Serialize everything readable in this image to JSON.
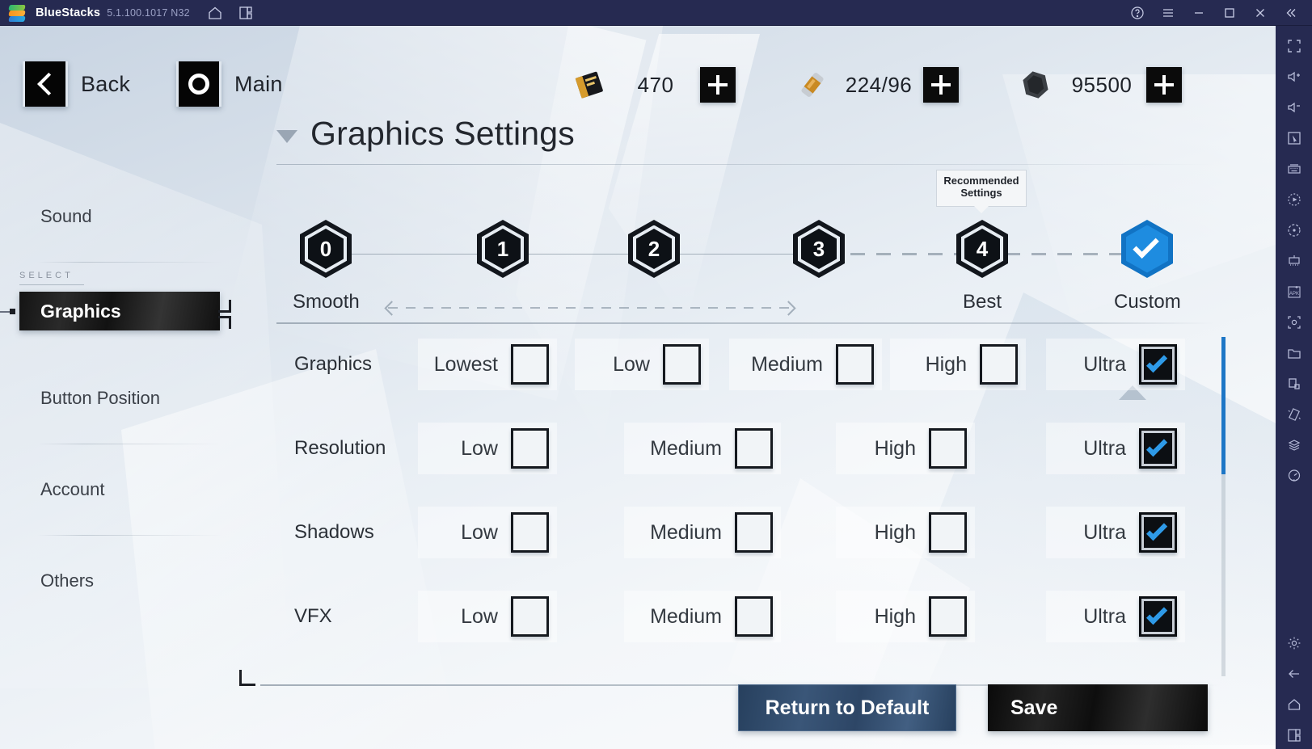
{
  "titlebar": {
    "app_name": "BlueStacks",
    "version": "5.1.100.1017 N32",
    "icons": [
      "home-icon",
      "multi-instance-icon"
    ],
    "window_icons": [
      "help-icon",
      "menu-icon",
      "minimize-icon",
      "maximize-icon",
      "close-icon",
      "collapse-icon"
    ]
  },
  "game": {
    "nav": {
      "back_label": "Back",
      "main_label": "Main"
    },
    "currencies": [
      {
        "icon": "uc-card-icon",
        "value": "470",
        "add_label": "+"
      },
      {
        "icon": "silver-fragment-icon",
        "value": "224/96",
        "add_label": "+"
      },
      {
        "icon": "nut-icon",
        "value": "95500",
        "add_label": "+"
      }
    ],
    "left_menu": {
      "select_hint": "SELECT",
      "items": [
        {
          "label": "Sound",
          "selected": false
        },
        {
          "label": "Graphics",
          "selected": true
        },
        {
          "label": "Button Position",
          "selected": false
        },
        {
          "label": "Account",
          "selected": false
        },
        {
          "label": "Others",
          "selected": false
        }
      ]
    },
    "page_title": "Graphics Settings",
    "stepper": {
      "tooltip": "Recommended\nSettings",
      "tooltip_line1": "Recommended",
      "tooltip_line2": "Settings",
      "nodes": [
        {
          "num": "0",
          "label": "Smooth",
          "selected": false
        },
        {
          "num": "1",
          "label": "",
          "selected": false
        },
        {
          "num": "2",
          "label": "",
          "selected": false
        },
        {
          "num": "3",
          "label": "",
          "selected": false
        },
        {
          "num": "4",
          "label": "Best",
          "selected": false
        },
        {
          "num": "",
          "label": "Custom",
          "selected": true,
          "icon": "check-icon"
        }
      ]
    },
    "settings_rows": [
      {
        "name": "Graphics",
        "options": [
          {
            "label": "Lowest",
            "checked": false
          },
          {
            "label": "Low",
            "checked": false
          },
          {
            "label": "Medium",
            "checked": false
          },
          {
            "label": "High",
            "checked": false
          },
          {
            "label": "Ultra",
            "checked": true
          }
        ]
      },
      {
        "name": "Resolution",
        "options": [
          {
            "label": "Low",
            "checked": false
          },
          {
            "label": "Medium",
            "checked": false
          },
          {
            "label": "High",
            "checked": false
          },
          {
            "label": "Ultra",
            "checked": true
          }
        ]
      },
      {
        "name": "Shadows",
        "options": [
          {
            "label": "Low",
            "checked": false
          },
          {
            "label": "Medium",
            "checked": false
          },
          {
            "label": "High",
            "checked": false
          },
          {
            "label": "Ultra",
            "checked": true
          }
        ]
      },
      {
        "name": "VFX",
        "options": [
          {
            "label": "Low",
            "checked": false
          },
          {
            "label": "Medium",
            "checked": false
          },
          {
            "label": "High",
            "checked": false
          },
          {
            "label": "Ultra",
            "checked": true
          }
        ]
      }
    ],
    "buttons": {
      "return_to_default": "Return to Default",
      "save": "Save"
    }
  },
  "right_rail": {
    "icons": [
      "fullscreen-icon",
      "volume-up-icon",
      "volume-down-icon",
      "cursor-icon",
      "keyboard-controls-icon",
      "macro-record-icon",
      "rotate-icon",
      "multi-instance-manager-icon",
      "install-apk-icon",
      "screenshot-icon",
      "media-folder-icon",
      "pip-icon",
      "shake-icon",
      "layers-icon",
      "performance-icon"
    ],
    "bottom_icons": [
      "settings-gear-icon",
      "back-arrow-icon",
      "home-icon",
      "recents-icon"
    ]
  },
  "colors": {
    "accent_blue": "#1e8ce0",
    "scrollbar_blue": "#1d76c6",
    "titlebar": "#262a51",
    "button_blue": "#3a5678"
  }
}
